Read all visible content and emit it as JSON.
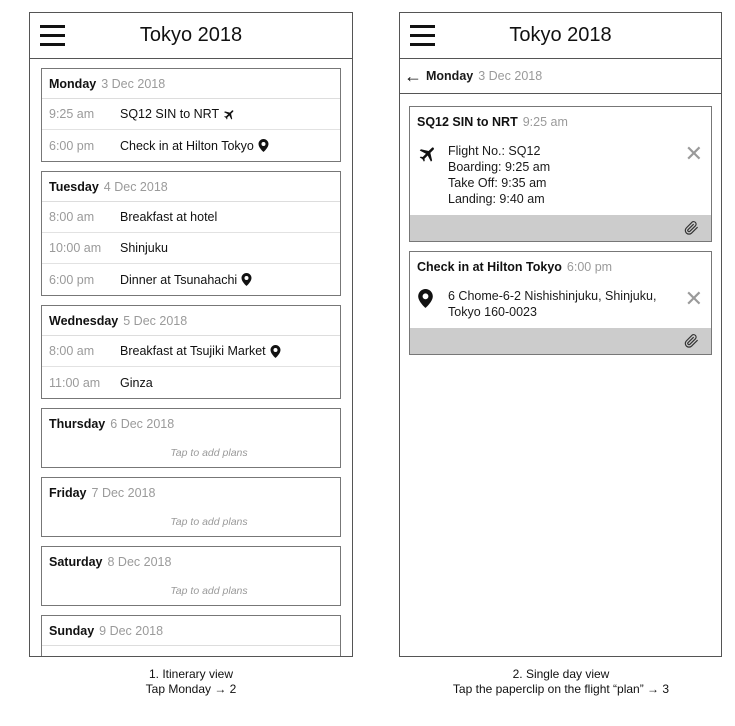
{
  "colors": {
    "border": "#555555",
    "muted": "#9a9a9a",
    "footer": "#cccccc"
  },
  "screen1": {
    "title": "Tokyo 2018",
    "days": [
      {
        "name": "Monday",
        "date": "3 Dec 2018",
        "plans": [
          {
            "time": "9:25 am",
            "title": "SQ12 SIN to NRT",
            "icon": "airplane-icon"
          },
          {
            "time": "6:00 pm",
            "title": "Check in at Hilton Tokyo",
            "icon": "location-pin-icon"
          }
        ]
      },
      {
        "name": "Tuesday",
        "date": "4 Dec 2018",
        "plans": [
          {
            "time": "8:00 am",
            "title": "Breakfast at hotel"
          },
          {
            "time": "10:00 am",
            "title": "Shinjuku"
          },
          {
            "time": "6:00 pm",
            "title": "Dinner at Tsunahachi",
            "icon": "location-pin-icon"
          }
        ]
      },
      {
        "name": "Wednesday",
        "date": "5 Dec 2018",
        "plans": [
          {
            "time": "8:00 am",
            "title": "Breakfast at Tsujiki Market",
            "icon": "location-pin-icon"
          },
          {
            "time": "11:00 am",
            "title": "Ginza"
          }
        ]
      },
      {
        "name": "Thursday",
        "date": "6 Dec 2018",
        "empty_hint": "Tap to add plans"
      },
      {
        "name": "Friday",
        "date": "7 Dec 2018",
        "empty_hint": "Tap to add plans"
      },
      {
        "name": "Saturday",
        "date": "8 Dec 2018",
        "empty_hint": "Tap to add plans"
      },
      {
        "name": "Sunday",
        "date": "9 Dec 2018"
      }
    ],
    "caption_line1": "1. Itinerary view",
    "caption_line2": "Tap Monday → 2"
  },
  "screen2": {
    "title": "Tokyo 2018",
    "back_day": "Monday",
    "back_date": "3 Dec 2018",
    "flight_card": {
      "title": "SQ12 SIN to NRT",
      "time": "9:25 am",
      "lines": [
        "Flight No.: SQ12",
        "Boarding: 9:25 am",
        "Take Off: 9:35 am",
        "Landing: 9:40 am"
      ]
    },
    "hotel_card": {
      "title": "Check in at Hilton Tokyo",
      "time": "6:00 pm",
      "lines": [
        "6 Chome-6-2 Nishishinjuku, Shinjuku,",
        "Tokyo 160-0023"
      ]
    },
    "caption_line1": "2. Single day view",
    "caption_line2": "Tap the paperclip on the flight “plan” → 3"
  }
}
